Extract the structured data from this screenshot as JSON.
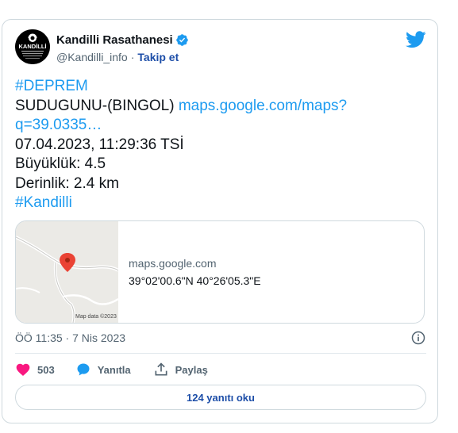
{
  "author": {
    "display_name": "Kandilli Rasathanesi",
    "handle": "@Kandilli_info",
    "separator": "·",
    "follow_label": "Takip et",
    "avatar_logo_text": "KANDİLLİ"
  },
  "tweet": {
    "lines": {
      "hashtag_deprem": "#DEPREM",
      "location": "SUDUGUNU-(BINGOL) ",
      "link_part1": "maps.google.com/maps?",
      "link_part2": "q=39.0335…",
      "datetime": "07.04.2023, 11:29:36 TSİ",
      "magnitude": "Büyüklük: 4.5",
      "depth": "Derinlik: 2.4 km",
      "hashtag_kandilli": "#Kandilli"
    }
  },
  "map_card": {
    "domain": "maps.google.com",
    "coordinates": "39°02'00.6\"N 40°26'05.3\"E",
    "credit": "Map data ©2023"
  },
  "meta": {
    "time": "ÖÖ 11:35 · 7 Nis 2023"
  },
  "actions": {
    "like_count": "503",
    "reply_label": "Yanıtla",
    "share_label": "Paylaş"
  },
  "read_replies_label": "124 yanıtı oku",
  "colors": {
    "link": "#1d9bf0",
    "like": "#f91880",
    "verified": "#1d9bf0",
    "bird": "#1d9bf0"
  }
}
